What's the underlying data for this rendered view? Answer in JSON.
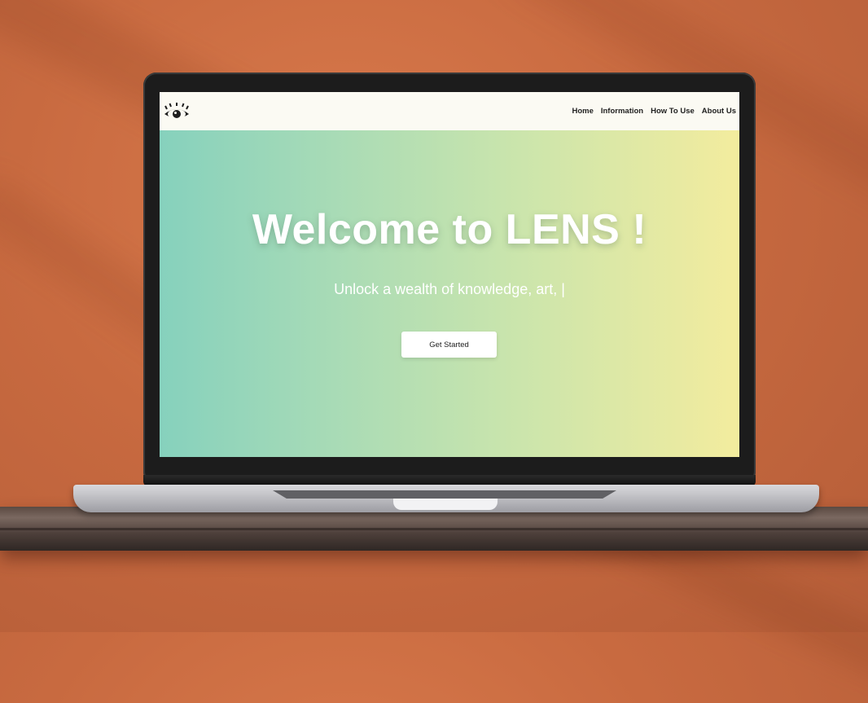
{
  "site": {
    "logo_icon": "eye-icon",
    "nav": {
      "items": [
        {
          "label": "Home"
        },
        {
          "label": "Information"
        },
        {
          "label": "How To Use"
        },
        {
          "label": "About Us"
        }
      ]
    },
    "hero": {
      "title": "Welcome to LENS !",
      "subtitle": "Unlock a wealth of knowledge, art, |",
      "cta_label": "Get Started"
    },
    "colors": {
      "gradient_start": "#86d1bd",
      "gradient_end": "#f3ec9e",
      "navbar_bg": "#fbfaf3"
    }
  }
}
